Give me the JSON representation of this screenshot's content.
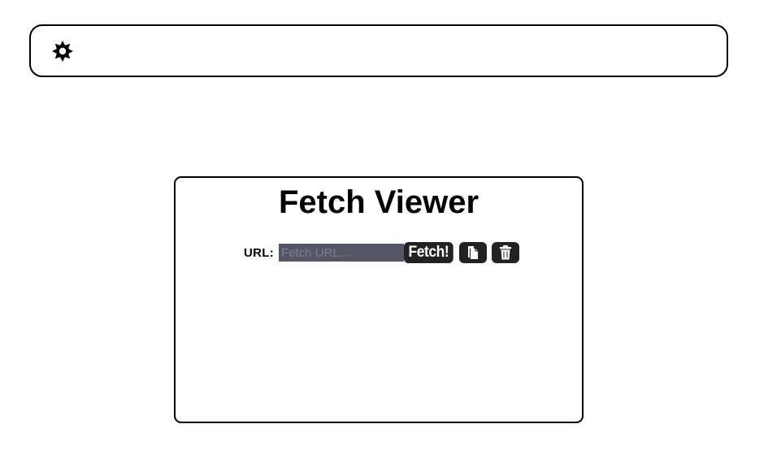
{
  "header": {
    "theme_icon": "sun-gear-icon"
  },
  "main": {
    "title": "Fetch Viewer",
    "url_label": "URL:",
    "url_input": {
      "value": "",
      "placeholder": "Fetch URL..."
    },
    "fetch_button_label": "Fetch!",
    "copy_icon": "copy-icon",
    "delete_icon": "trash-icon"
  },
  "colors": {
    "input_bg": "#555566",
    "button_bg": "#222222",
    "border": "#000000"
  }
}
